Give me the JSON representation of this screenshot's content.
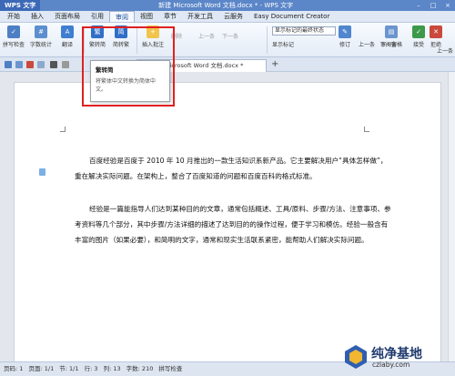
{
  "title_bar": {
    "app_button": "WPS 文字",
    "title": "新建 Microsoft Word 文档.docx * - WPS 文字"
  },
  "menu": {
    "tabs": [
      "开始",
      "插入",
      "页面布局",
      "引用",
      "审阅",
      "视图",
      "章节",
      "开发工具",
      "云服务",
      "Easy Document Creator"
    ],
    "active_tab": "审阅"
  },
  "ribbon": {
    "spellcheck": "拼写检查",
    "word_count": "字数统计",
    "translate": "翻译",
    "trad_to_simp": "繁转简",
    "simp_to_trad": "简转繁",
    "insert_comment": "插入批注",
    "delete": "删除",
    "prev1": "上一条",
    "next1": "下一条",
    "display_state": "显示标记的最终状态",
    "show_markup": "显示标记",
    "revise": "修订",
    "prev2": "上一条",
    "next2": "下一条",
    "review_pane": "审阅窗格",
    "accept": "接受",
    "reject": "拒绝",
    "prev3": "上一条"
  },
  "doc_tab": {
    "title": "Microsoft Word 文档.docx *"
  },
  "tooltip": {
    "title": "繁转简",
    "description": "将繁体中文转换为简体中文。"
  },
  "document": {
    "paragraphs": [
      "百度经验是百度于 2010 年 10 月推出的一款生活知识系新产品。它主要解决用户“具体怎样做”，重在解决实际问题。在架构上，整合了百度知道的问题和百度百科的格式标准。",
      "经验是一篇能指导人们达到某种目的的文章，通常包括概述、工具/原料、步骤/方法、注意事项、参考资料等几个部分，其中步骤/方法详细的描述了达到目的的操作过程，便于学习和模仿。经验一般含有丰富的图片（如果必要），和简明的文字，通常和现实生活联系紧密，能帮助人们解决实际问题。"
    ]
  },
  "status_bar": {
    "page_num": "页码: 1",
    "page_count": "页面: 1/1",
    "section": "节: 1/1",
    "row": "行: 3",
    "col": "列: 13",
    "word_count": "字数: 210",
    "spell_check": "拼写检查"
  },
  "watermark": {
    "text": "纯净基地",
    "url": "czlaby.com"
  },
  "colors": {
    "title_bar": "#5b86c8",
    "highlight_box": "#e02020",
    "watermark_text": "#1f3a6e"
  }
}
